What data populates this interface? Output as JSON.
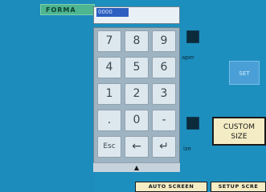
{
  "format_tab": "FORMA",
  "list_items": [
    "",
    "",
    "",
    "",
    "",
    "",
    "",
    "",
    "",
    "",
    "",
    "",
    "",
    "",
    "",
    "",
    "",
    "",
    "",
    "",
    ""
  ],
  "entry_value": "0000",
  "keys": [
    {
      "label": "7"
    },
    {
      "label": "8"
    },
    {
      "label": "9"
    },
    {
      "label": "4"
    },
    {
      "label": "5"
    },
    {
      "label": "6"
    },
    {
      "label": "1"
    },
    {
      "label": "2"
    },
    {
      "label": "3"
    },
    {
      "label": "."
    },
    {
      "label": "0"
    },
    {
      "label": "-"
    },
    {
      "label": "Esc"
    },
    {
      "label": "←"
    },
    {
      "label": "↵"
    }
  ],
  "collapse_arrow": "▲",
  "side_labels": {
    "top": "aper",
    "bottom": "ize"
  },
  "set_button": "SET",
  "custom_button": {
    "line1": "CUSTOM",
    "line2": "SIZE"
  },
  "auto_screen": "AUTO SCREEN",
  "setup_screen": "SETUP SCRE"
}
